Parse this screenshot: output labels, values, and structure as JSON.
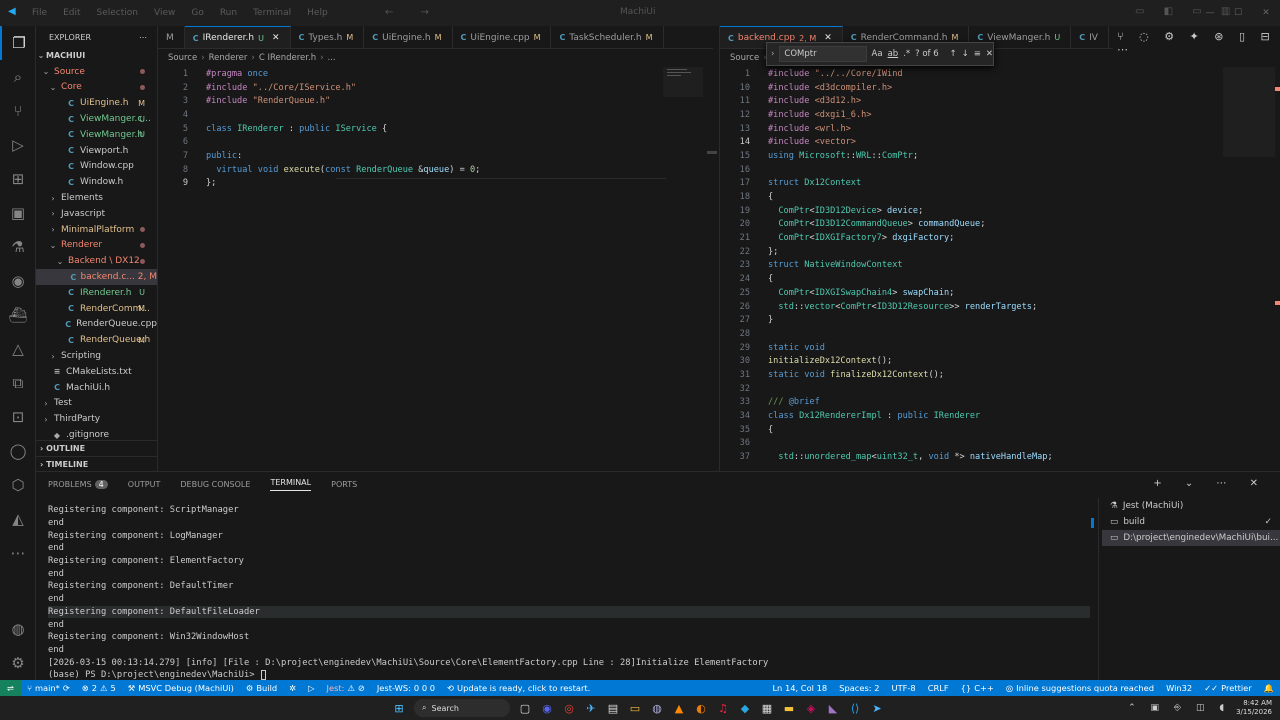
{
  "menu": [
    "File",
    "Edit",
    "Selection",
    "View",
    "Go",
    "Run",
    "Terminal",
    "Help"
  ],
  "window_title": "MachiUi",
  "explorer": {
    "title": "EXPLORER",
    "root": "MACHIUI",
    "tree": [
      {
        "label": "Source",
        "indent": 1,
        "tw": "⌄",
        "cls": "c-err",
        "dot": true
      },
      {
        "label": "Core",
        "indent": 2,
        "tw": "⌄",
        "cls": "c-err",
        "dot": true
      },
      {
        "label": "UiEngine.h",
        "indent": 3,
        "icon": "C",
        "iconcls": "ic-cpp",
        "cls": "c-mod",
        "badge": "M"
      },
      {
        "label": "ViewManger.c...",
        "indent": 3,
        "icon": "C",
        "iconcls": "ic-cpp",
        "cls": "c-untr",
        "badge": "U"
      },
      {
        "label": "ViewManger.h",
        "indent": 3,
        "icon": "C",
        "iconcls": "ic-cpp",
        "cls": "c-untr",
        "badge": "U"
      },
      {
        "label": "Viewport.h",
        "indent": 3,
        "icon": "C",
        "iconcls": "ic-cpp",
        "cls": "c-grey"
      },
      {
        "label": "Window.cpp",
        "indent": 3,
        "icon": "C",
        "iconcls": "ic-cpp",
        "cls": "c-grey"
      },
      {
        "label": "Window.h",
        "indent": 3,
        "icon": "C",
        "iconcls": "ic-cpp",
        "cls": "c-grey"
      },
      {
        "label": "Elements",
        "indent": 2,
        "tw": "›",
        "cls": "c-grey"
      },
      {
        "label": "Javascript",
        "indent": 2,
        "tw": "›",
        "cls": "c-grey"
      },
      {
        "label": "MinimalPlatform",
        "indent": 2,
        "tw": "›",
        "cls": "c-mod",
        "dot": true
      },
      {
        "label": "Renderer",
        "indent": 2,
        "tw": "⌄",
        "cls": "c-err",
        "dot": true
      },
      {
        "label": "Backend \\ DX12",
        "indent": 3,
        "tw": "⌄",
        "cls": "c-err",
        "dot": true
      },
      {
        "label": "backend.c... 2, M",
        "indent": 4,
        "icon": "C",
        "iconcls": "ic-cpp",
        "cls": "c-err",
        "sel": true
      },
      {
        "label": "IRenderer.h",
        "indent": 3,
        "icon": "C",
        "iconcls": "ic-cpp",
        "cls": "c-untr",
        "badge": "U"
      },
      {
        "label": "RenderComm...",
        "indent": 3,
        "icon": "C",
        "iconcls": "ic-cpp",
        "cls": "c-mod",
        "badge": "M"
      },
      {
        "label": "RenderQueue.cpp",
        "indent": 3,
        "icon": "C",
        "iconcls": "ic-cpp",
        "cls": "c-grey"
      },
      {
        "label": "RenderQueue.h",
        "indent": 3,
        "icon": "C",
        "iconcls": "ic-cpp",
        "cls": "c-mod",
        "badge": "M"
      },
      {
        "label": "Scripting",
        "indent": 2,
        "tw": "›",
        "cls": "c-grey"
      },
      {
        "label": "CMakeLists.txt",
        "indent": 1,
        "icon": "≡",
        "iconcls": "ic-txt",
        "cls": "c-grey"
      },
      {
        "label": "MachiUi.h",
        "indent": 1,
        "icon": "C",
        "iconcls": "ic-cpp",
        "cls": "c-grey"
      },
      {
        "label": "Test",
        "indent": 1,
        "tw": "›",
        "cls": "c-grey"
      },
      {
        "label": "ThirdParty",
        "indent": 1,
        "tw": "›",
        "cls": "c-grey"
      },
      {
        "label": ".gitignore",
        "indent": 1,
        "icon": "◆",
        "iconcls": "ic-txt",
        "cls": "c-grey"
      }
    ],
    "outline": "OUTLINE",
    "timeline": "TIMELINE"
  },
  "left_tabs": [
    {
      "label": "M",
      "icon": "",
      "status": ""
    },
    {
      "label": "IRenderer.h",
      "icon": "C",
      "status": "U",
      "active": true,
      "close": true
    },
    {
      "label": "Types.h",
      "icon": "C",
      "status": "M"
    },
    {
      "label": "UiEngine.h",
      "icon": "C",
      "status": "M"
    },
    {
      "label": "UiEngine.cpp",
      "icon": "C",
      "status": "M"
    },
    {
      "label": "TaskScheduler.h",
      "icon": "C",
      "status": "M"
    }
  ],
  "right_tabs": [
    {
      "label": "backend.cpp",
      "icon": "C",
      "status": "2, M",
      "active": true,
      "close": true
    },
    {
      "label": "RenderCommand.h",
      "icon": "C",
      "status": "M"
    },
    {
      "label": "ViewManger.h",
      "icon": "C",
      "status": "U"
    },
    {
      "label": "IV",
      "icon": "C",
      "status": ""
    }
  ],
  "left_breadcrumb": [
    "Source",
    "Renderer",
    "C IRenderer.h",
    "..."
  ],
  "right_breadcrumb": [
    "Source",
    "Renderer",
    "Backend",
    "DX12",
    "C backend.cpp",
    "..."
  ],
  "left_code": [
    {
      "n": "1",
      "h": "<span class='pp'>#pragma</span> <span class='kw'>once</span>"
    },
    {
      "n": "2",
      "h": "<span class='pp'>#include</span> <span class='st'>\"../Core/IService.h\"</span>"
    },
    {
      "n": "3",
      "h": "<span class='pp'>#include</span> <span class='st'>\"RenderQueue.h\"</span>"
    },
    {
      "n": "4",
      "h": ""
    },
    {
      "n": "5",
      "h": "<span class='kw'>class</span> <span class='ty'>IRenderer</span> : <span class='kw'>public</span> <span class='ty'>IService</span> {"
    },
    {
      "n": "6",
      "h": ""
    },
    {
      "n": "7",
      "h": "<span class='kw'>public</span>:"
    },
    {
      "n": "8",
      "h": "  <span class='kw'>virtual</span> <span class='kw'>void</span> <span class='fn'>execute</span>(<span class='kw'>const</span> <span class='ty'>RenderQueue</span> &amp;<span class='va'>queue</span>) = <span class='nu'>0</span>;"
    },
    {
      "n": "9",
      "h": "};",
      "cur": true
    }
  ],
  "right_code": [
    {
      "n": "1",
      "h": "<span class='pp'>#include</span> <span class='st'>\"../../Core/IWind</span>"
    },
    {
      "n": "10",
      "h": "<span class='pp'>#include</span> <span class='st'>&lt;d3dcompiler.h&gt;</span>"
    },
    {
      "n": "11",
      "h": "<span class='pp'>#include</span> <span class='st'>&lt;d3d12.h&gt;</span>"
    },
    {
      "n": "12",
      "h": "<span class='pp'>#include</span> <span class='st'>&lt;dxgi1_6.h&gt;</span>"
    },
    {
      "n": "13",
      "h": "<span class='pp'>#include</span> <span class='st'>&lt;wrl.h&gt;</span>"
    },
    {
      "n": "14",
      "h": "<span class='pp'>#include</span> <span class='st'>&lt;vector&gt;</span>",
      "cur": true
    },
    {
      "n": "15",
      "h": "<span class='kw'>using</span> <span class='ty'>Microsoft</span>::<span class='ty'>WRL</span>::<span class='ty'>ComPtr</span>;"
    },
    {
      "n": "16",
      "h": ""
    },
    {
      "n": "17",
      "h": "<span class='kw'>struct</span> <span class='ty'>Dx12Context</span>"
    },
    {
      "n": "18",
      "h": "{"
    },
    {
      "n": "19",
      "h": "  <span class='ty'>ComPtr</span>&lt;<span class='ty'>ID3D12Device</span>&gt; <span class='va'>device</span>;"
    },
    {
      "n": "20",
      "h": "  <span class='ty'>ComPtr</span>&lt;<span class='ty'>ID3D12CommandQueue</span>&gt; <span class='va'>commandQueue</span>;"
    },
    {
      "n": "21",
      "h": "  <span class='ty'>ComPtr</span>&lt;<span class='ty'>IDXGIFactory7</span>&gt; <span class='va'>dxgiFactory</span>;"
    },
    {
      "n": "22",
      "h": "};"
    },
    {
      "n": "23",
      "h": "<span class='kw'>struct</span> <span class='ty'>NativeWindowContext</span>"
    },
    {
      "n": "24",
      "h": "{"
    },
    {
      "n": "25",
      "h": "  <span class='ty'>ComPtr</span>&lt;<span class='ty'>IDXGISwapChain4</span>&gt; <span class='va'>swapChain</span>;"
    },
    {
      "n": "26",
      "h": "  <span class='ty'>std</span>::<span class='ty'>vector</span>&lt;<span class='ty'>ComPtr</span>&lt;<span class='ty'>ID3D12Resource</span>&gt;&gt; <span class='va'>renderTargets</span>;"
    },
    {
      "n": "27",
      "h": "}"
    },
    {
      "n": "28",
      "h": ""
    },
    {
      "n": "29",
      "h": "<span class='kw'>static</span> <span class='kw'>void</span>"
    },
    {
      "n": "30",
      "h": "<span class='fn'>initializeDx12Context</span>();"
    },
    {
      "n": "31",
      "h": "<span class='kw'>static</span> <span class='kw'>void</span> <span class='fn'>finalizeDx12Context</span>();"
    },
    {
      "n": "32",
      "h": ""
    },
    {
      "n": "33",
      "h": "<span class='cm'>/// </span><span class='kw'>@brief</span>"
    },
    {
      "n": "34",
      "h": "<span class='kw'>class</span> <span class='ty'>Dx12RendererImpl</span> : <span class='kw'>public</span> <span class='ty'>IRenderer</span>"
    },
    {
      "n": "35",
      "h": "{"
    },
    {
      "n": "36",
      "h": ""
    },
    {
      "n": "37",
      "h": "  <span class='ty'>std</span>::<span class='ty'>unordered_map</span>&lt;<span class='ty'>uint32_t</span>, <span class='kw'>void</span> *&gt; <span class='va'>nativeHandleMap</span>;"
    }
  ],
  "find": {
    "value": "COMptr",
    "case": "Aa",
    "word": "ab",
    "regex": ".*",
    "result": "? of 6"
  },
  "panel": {
    "tabs": [
      "PROBLEMS",
      "OUTPUT",
      "DEBUG CONSOLE",
      "TERMINAL",
      "PORTS"
    ],
    "problems_count": "4",
    "active": "TERMINAL"
  },
  "terminal": [
    "Registering component: ScriptManager",
    "end",
    "Registering component: LogManager",
    "end",
    "Registering component: ElementFactory",
    "end",
    "Registering component: DefaultTimer",
    "end",
    "Registering component: DefaultFileLoader",
    "end",
    "Registering component: Win32WindowHost",
    "end",
    "[2026-03-15 00:13:14.279] [info] [File : D:\\project\\enginedev\\MachiUi\\Source\\Core\\ElementFactory.cpp Line : 28]Initialize ElementFactory",
    "(base) PS D:\\project\\enginedev\\MachiUi> "
  ],
  "terminals": [
    "Jest (MachiUi)",
    "build",
    "D:\\project\\enginedev\\MachiUi\\bui..."
  ],
  "status": {
    "branch": "main*",
    "errors": "2",
    "warnings": "5",
    "debug": "MSVC Debug (MachiUi)",
    "build": "Build",
    "jest": "Jest:",
    "jestws": "Jest-WS:",
    "jestcounts": "0  0  0",
    "update": "Update is ready, click to restart.",
    "pos": "Ln 14, Col 18",
    "spaces": "Spaces: 2",
    "enc": "UTF-8",
    "eol": "CRLF",
    "lang": "C++",
    "inline": "Inline suggestions quota reached",
    "platform": "Win32",
    "prettier": "Prettier"
  },
  "taskbar": {
    "search": "Search",
    "time": "8:42 AM",
    "date": "3/15/2026"
  }
}
